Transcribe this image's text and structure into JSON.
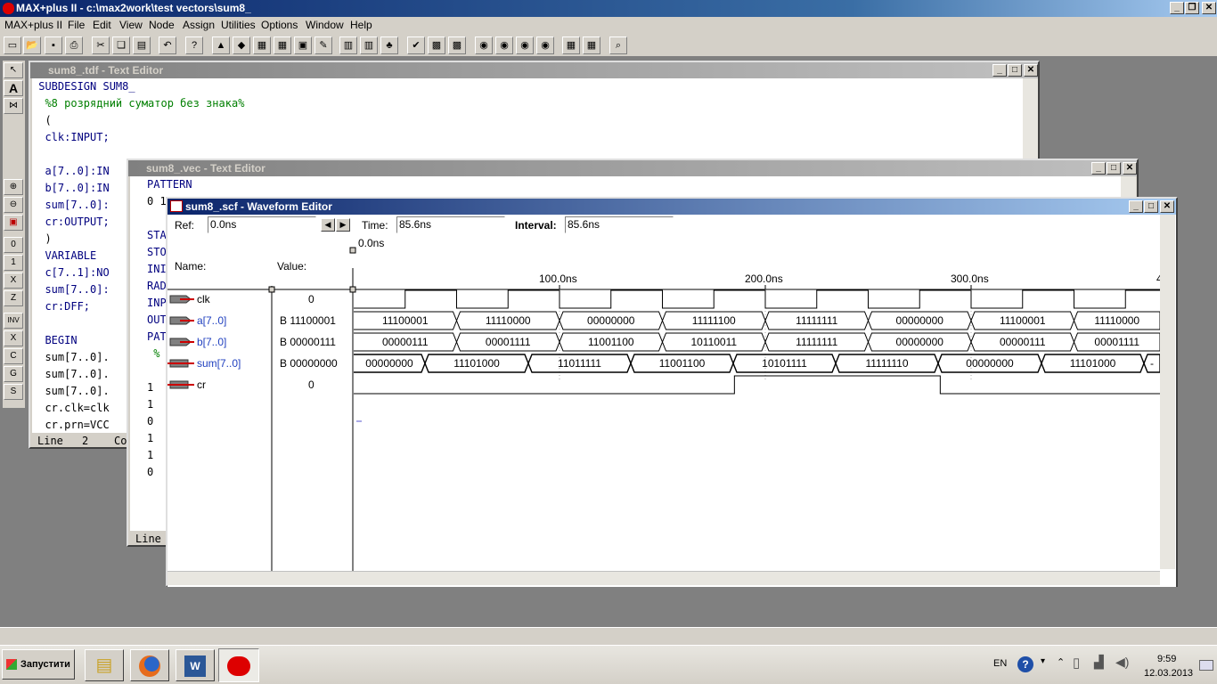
{
  "app": {
    "title": "MAX+plus II - c:\\max2work\\test vectors\\sum8_",
    "menu": [
      "MAX+plus II",
      "File",
      "Edit",
      "View",
      "Node",
      "Assign",
      "Utilities",
      "Options",
      "Window",
      "Help"
    ]
  },
  "tdf": {
    "title": "sum8_.tdf - Text Editor",
    "lines": [
      {
        "text": " SUBDESIGN SUM8_",
        "cls": "kw"
      },
      {
        "text": "  %8 розрядний суматор без знака%",
        "cls": "cm"
      },
      {
        "text": "  (",
        "cls": ""
      },
      {
        "text": "  clk:INPUT;",
        "cls": "kw"
      },
      {
        "text": "",
        "cls": ""
      },
      {
        "text": "  a[7..0]:IN",
        "cls": "kw"
      },
      {
        "text": "  b[7..0]:IN",
        "cls": "kw"
      },
      {
        "text": "  sum[7..0]:",
        "cls": "kw"
      },
      {
        "text": "  cr:OUTPUT;",
        "cls": "kw"
      },
      {
        "text": "  )",
        "cls": ""
      },
      {
        "text": "  VARIABLE",
        "cls": "kw"
      },
      {
        "text": "  c[7..1]:NO",
        "cls": "kw"
      },
      {
        "text": "  sum[7..0]:",
        "cls": "kw"
      },
      {
        "text": "  cr:DFF;",
        "cls": "kw"
      },
      {
        "text": "",
        "cls": ""
      },
      {
        "text": "  BEGIN",
        "cls": "kw"
      },
      {
        "text": "  sum[7..0].",
        "cls": ""
      },
      {
        "text": "  sum[7..0].",
        "cls": ""
      },
      {
        "text": "  sum[7..0].",
        "cls": ""
      },
      {
        "text": "  cr.clk=clk",
        "cls": ""
      },
      {
        "text": "  cr.prn=VCC",
        "cls": ""
      }
    ],
    "status_line": "Line",
    "status_line_no": "2",
    "status_col": "Co"
  },
  "vec": {
    "title": "sum8_.vec - Text Editor",
    "lines": [
      {
        "text": "PATTERN",
        "cls": "kw"
      },
      {
        "text": "0 1",
        "cls": ""
      },
      {
        "text": "",
        "cls": ""
      },
      {
        "text": "STA",
        "cls": "kw"
      },
      {
        "text": "STO",
        "cls": "kw"
      },
      {
        "text": "INI",
        "cls": "kw"
      },
      {
        "text": "RAD",
        "cls": "kw"
      },
      {
        "text": "INP",
        "cls": "kw"
      },
      {
        "text": "OUT",
        "cls": "kw"
      },
      {
        "text": "PAT",
        "cls": "kw"
      },
      {
        "text": " %",
        "cls": "cm"
      },
      {
        "text": "",
        "cls": ""
      },
      {
        "text": "1",
        "cls": ""
      },
      {
        "text": "1",
        "cls": ""
      },
      {
        "text": "0",
        "cls": ""
      },
      {
        "text": "1",
        "cls": ""
      },
      {
        "text": "1",
        "cls": ""
      },
      {
        "text": "0",
        "cls": ""
      }
    ],
    "status_line": "Line"
  },
  "scf": {
    "title": "sum8_.scf - Waveform Editor",
    "ref_label": "Ref:",
    "ref_value": "0.0ns",
    "time_label": "Time:",
    "time_value": "85.6ns",
    "interval_label": "Interval:",
    "interval_value": "85.6ns",
    "cursor_label": "0.0ns",
    "name_header": "Name:",
    "value_header": "Value:",
    "time_ticks": [
      "100.0ns",
      "200.0ns",
      "300.0ns",
      "4"
    ],
    "signals": [
      {
        "name": "clk",
        "value": "0",
        "kind": "input"
      },
      {
        "name": "a[7..0]",
        "value": "B 11100001",
        "kind": "input-bus",
        "segments": [
          "11100001",
          "11110000",
          "00000000",
          "11111100",
          "11111111",
          "00000000",
          "11100001",
          "11110000"
        ]
      },
      {
        "name": "b[7..0]",
        "value": "B 00000111",
        "kind": "input-bus",
        "segments": [
          "00000111",
          "00001111",
          "11001100",
          "10110011",
          "11111111",
          "00000000",
          "00000111",
          "00001111"
        ]
      },
      {
        "name": "sum[7..0]",
        "value": "B 00000000",
        "kind": "output-bus",
        "segments": [
          "00000000",
          "11101000",
          "11011111",
          "11001100",
          "10101111",
          "11111110",
          "00000000",
          "11101000",
          "-"
        ]
      },
      {
        "name": "cr",
        "value": "0",
        "kind": "output"
      }
    ]
  },
  "taskbar": {
    "start": "Запустити",
    "lang": "EN",
    "time": "9:59",
    "date": "12.03.2013"
  }
}
